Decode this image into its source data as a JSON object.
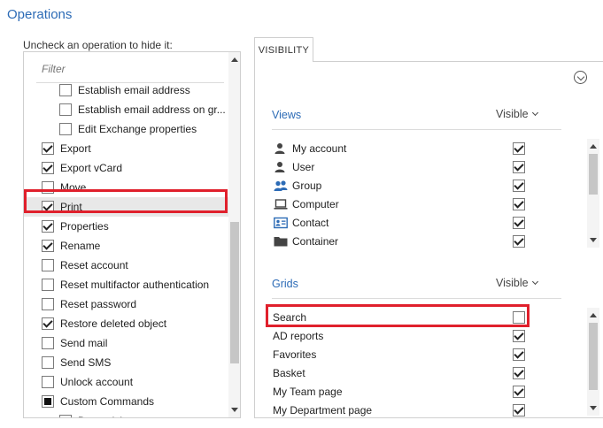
{
  "section": {
    "title": "Operations"
  },
  "operations": {
    "hint": "Uncheck an operation to hide it:",
    "filter_placeholder": "Filter",
    "items": [
      {
        "label": "Establish email address",
        "indent": 1,
        "state": "unchecked"
      },
      {
        "label": "Establish email address on gr...",
        "indent": 1,
        "state": "unchecked"
      },
      {
        "label": "Edit Exchange properties",
        "indent": 1,
        "state": "unchecked"
      },
      {
        "label": "Export",
        "indent": 0,
        "state": "checked"
      },
      {
        "label": "Export vCard",
        "indent": 0,
        "state": "checked"
      },
      {
        "label": "Move",
        "indent": 0,
        "state": "unchecked"
      },
      {
        "label": "Print",
        "indent": 0,
        "state": "checked",
        "selected": true
      },
      {
        "label": "Properties",
        "indent": 0,
        "state": "checked"
      },
      {
        "label": "Rename",
        "indent": 0,
        "state": "checked"
      },
      {
        "label": "Reset account",
        "indent": 0,
        "state": "unchecked"
      },
      {
        "label": "Reset multifactor authentication",
        "indent": 0,
        "state": "unchecked"
      },
      {
        "label": "Reset password",
        "indent": 0,
        "state": "unchecked"
      },
      {
        "label": "Restore deleted object",
        "indent": 0,
        "state": "checked"
      },
      {
        "label": "Send mail",
        "indent": 0,
        "state": "unchecked"
      },
      {
        "label": "Send SMS",
        "indent": 0,
        "state": "unchecked"
      },
      {
        "label": "Unlock account",
        "indent": 0,
        "state": "unchecked"
      },
      {
        "label": "Custom Commands",
        "indent": 0,
        "state": "partial"
      },
      {
        "label": "Deprovision",
        "indent": 1,
        "state": "unchecked"
      }
    ]
  },
  "visibility": {
    "tab_label": "VISIBILITY",
    "views": {
      "title": "Views",
      "visible_label": "Visible",
      "items": [
        {
          "label": "My account",
          "icon": "person-icon",
          "checked": true
        },
        {
          "label": "User",
          "icon": "person-icon",
          "checked": true
        },
        {
          "label": "Group",
          "icon": "group-icon",
          "checked": true
        },
        {
          "label": "Computer",
          "icon": "laptop-icon",
          "checked": true
        },
        {
          "label": "Contact",
          "icon": "contact-card-icon",
          "checked": true
        },
        {
          "label": "Container",
          "icon": "folder-icon",
          "checked": true
        }
      ]
    },
    "grids": {
      "title": "Grids",
      "visible_label": "Visible",
      "items": [
        {
          "label": "Search",
          "checked": false
        },
        {
          "label": "AD reports",
          "checked": true
        },
        {
          "label": "Favorites",
          "checked": true
        },
        {
          "label": "Basket",
          "checked": true
        },
        {
          "label": "My Team page",
          "checked": true
        },
        {
          "label": "My Department page",
          "checked": true
        }
      ]
    }
  },
  "colors": {
    "accent": "#2c6bb6",
    "highlight": "#e0202c",
    "group_icon": "#2c6bb6",
    "contact_icon": "#2c6bb6"
  }
}
